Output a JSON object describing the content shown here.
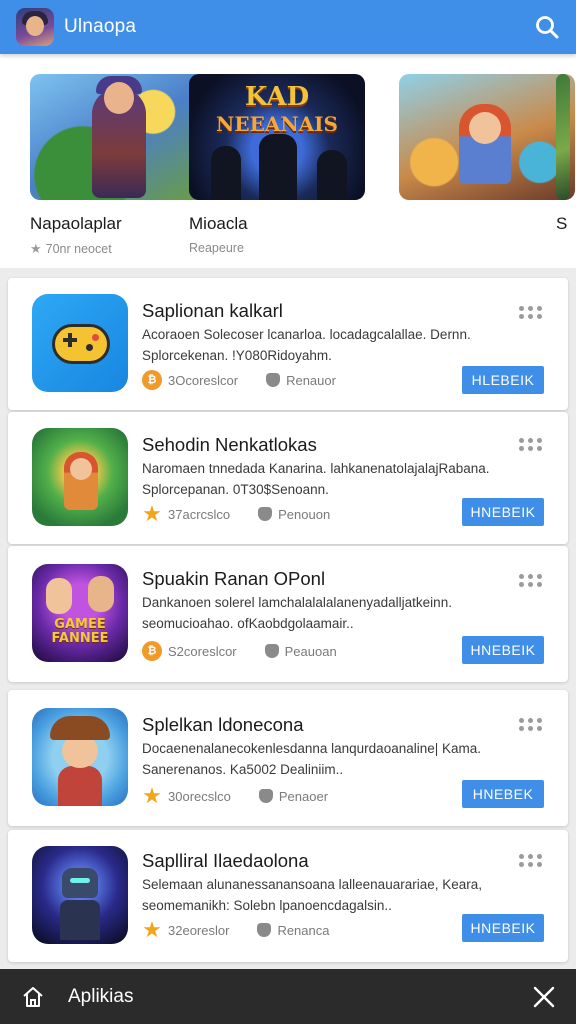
{
  "header": {
    "title": "Ulnaopa",
    "logo_icon": "game-avatar-logo",
    "search_icon": "search-icon",
    "color": "#3f8fe8"
  },
  "featured": [
    {
      "name": "Napaolaplar",
      "subtitle": "70nr neocet"
    },
    {
      "name": "Mioacla",
      "subtitle": "Reapeure",
      "art_line1": "KAD",
      "art_line2": "NEEANAIS"
    },
    {
      "name": "S",
      "subtitle": ""
    }
  ],
  "apps": [
    {
      "title": "Saplionan kalkarl",
      "desc1": "Acoraoen Solecoser lcanarloa. locadagcalallae. Dernn.",
      "desc2": "Splorcekenan. !Y080Ridoyahm.",
      "rating": "3Ocoreslcor",
      "rating_icon": "coin-icon",
      "tag": "Renauor",
      "button": "HLEBEIK"
    },
    {
      "title": "Sehodin Nenkatlokas",
      "desc1": "Naromaen tnnedada Kanarina. lahkanenatolajalajRabana.",
      "desc2": "Splorcepanan. 0T30$Senoann.",
      "rating": "37acrcslco",
      "rating_icon": "star-icon",
      "tag": "Penouon",
      "button": "HNEBEIK"
    },
    {
      "title": "Spuakin Ranan OPonl",
      "desc1": "Dankanoen solerel lamchalalalalanenyadalljatkeinn.",
      "desc2": "seomucioahao. ofKaobdgolaamair..",
      "rating": "S2coreslcor",
      "rating_icon": "coin-icon",
      "tag": "Peauoan",
      "button": "HNEBEIK",
      "icon_text": "GAMEE FANNEE"
    },
    {
      "title": "Splelkan ldonecona",
      "desc1": "Docaenenalanecokenlesdanna lanqurdaoanaline| Kama.",
      "desc2": "Sanerenanos. Ka5002 Dealiniim..",
      "rating": "30orecslco",
      "rating_icon": "star-icon",
      "tag": "Penaoer",
      "button": "HNEBEK"
    },
    {
      "title": "Saplliral Ilaedaolona",
      "desc1": "Selemaan alunanessanansoana lalleenauarariae, Keara,",
      "desc2": "seomemanikh: Solebn lpanoencdagalsin..",
      "rating": "32eoreslor",
      "rating_icon": "star-icon",
      "tag": "Renanca",
      "button": "HNEBEIK"
    }
  ],
  "bottom": {
    "label": "Aplikias",
    "home_icon": "home-icon",
    "close_icon": "close-icon"
  }
}
